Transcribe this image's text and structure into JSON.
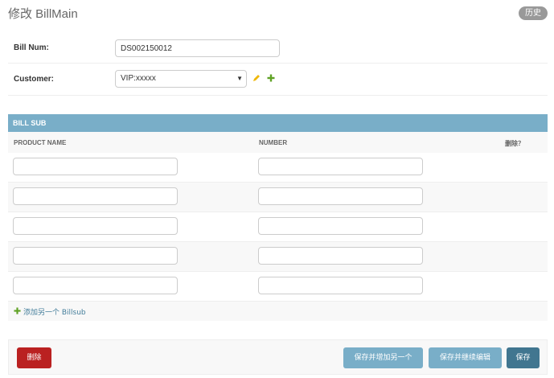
{
  "header": {
    "title": "修改 BillMain",
    "history_label": "历史"
  },
  "form": {
    "bill_num": {
      "label": "Bill Num:",
      "value": "DS002150012"
    },
    "customer": {
      "label": "Customer:",
      "selected": "VIP:xxxxx"
    }
  },
  "inline": {
    "title": "BILL SUB",
    "columns": {
      "product": "PRODUCT NAME",
      "number": "NUMBER",
      "delete": "删除？"
    },
    "add_label": "添加另一个 Billsub"
  },
  "submit": {
    "delete_label": "删除",
    "save_add_label": "保存并增加另一个",
    "save_continue_label": "保存并继续编辑",
    "save_label": "保存"
  },
  "colors": {
    "accent": "#79aec8",
    "primary": "#417690",
    "danger": "#ba2121",
    "link": "#447e9b",
    "add_green": "#5fa225",
    "edit_yellow": "#efb80b"
  },
  "icons": {
    "edit": "pencil-icon",
    "add": "plus-icon",
    "select": "caret-down-icon"
  }
}
